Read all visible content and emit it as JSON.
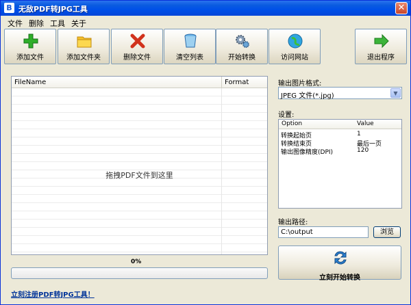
{
  "window": {
    "title": "无敌PDF转JPG工具",
    "app_icon": "B"
  },
  "menu": [
    "文件",
    "删除",
    "工具",
    "关于"
  ],
  "toolbar": [
    {
      "id": "add-file",
      "label": "添加文件",
      "icon": "green-plus-icon"
    },
    {
      "id": "add-folder",
      "label": "添加文件夹",
      "icon": "folder-icon"
    },
    {
      "id": "delete-file",
      "label": "删除文件",
      "icon": "red-x-icon"
    },
    {
      "id": "clear-list",
      "label": "清空列表",
      "icon": "trash-can-icon"
    },
    {
      "id": "start-convert",
      "label": "开始转换",
      "icon": "gears-icon"
    },
    {
      "id": "visit-website",
      "label": "访问网站",
      "icon": "globe-icon"
    },
    {
      "id": "exit",
      "label": "退出程序",
      "icon": "green-arrow-right-icon"
    }
  ],
  "file_list": {
    "columns": [
      "FileName",
      "Format"
    ],
    "drop_hint": "拖拽PDF文件到这里"
  },
  "progress": {
    "text": "0%",
    "value": 0
  },
  "register_link": "立刻注册PDF转JPG工具！",
  "output_format": {
    "label": "输出图片格式:",
    "value": "JPEG 文件(*.jpg)"
  },
  "settings": {
    "label": "设置:",
    "columns": [
      "Option",
      "Value"
    ],
    "rows": [
      {
        "option": "转换起始页",
        "value": "1"
      },
      {
        "option": "转换结束页",
        "value": "最后一页"
      },
      {
        "option": "输出图像精度(DPI)",
        "value": "120"
      }
    ]
  },
  "output_path": {
    "label": "输出路径:",
    "value": "C:\\output",
    "browse": "浏览"
  },
  "start_button": {
    "label": "立刻开始转换"
  }
}
